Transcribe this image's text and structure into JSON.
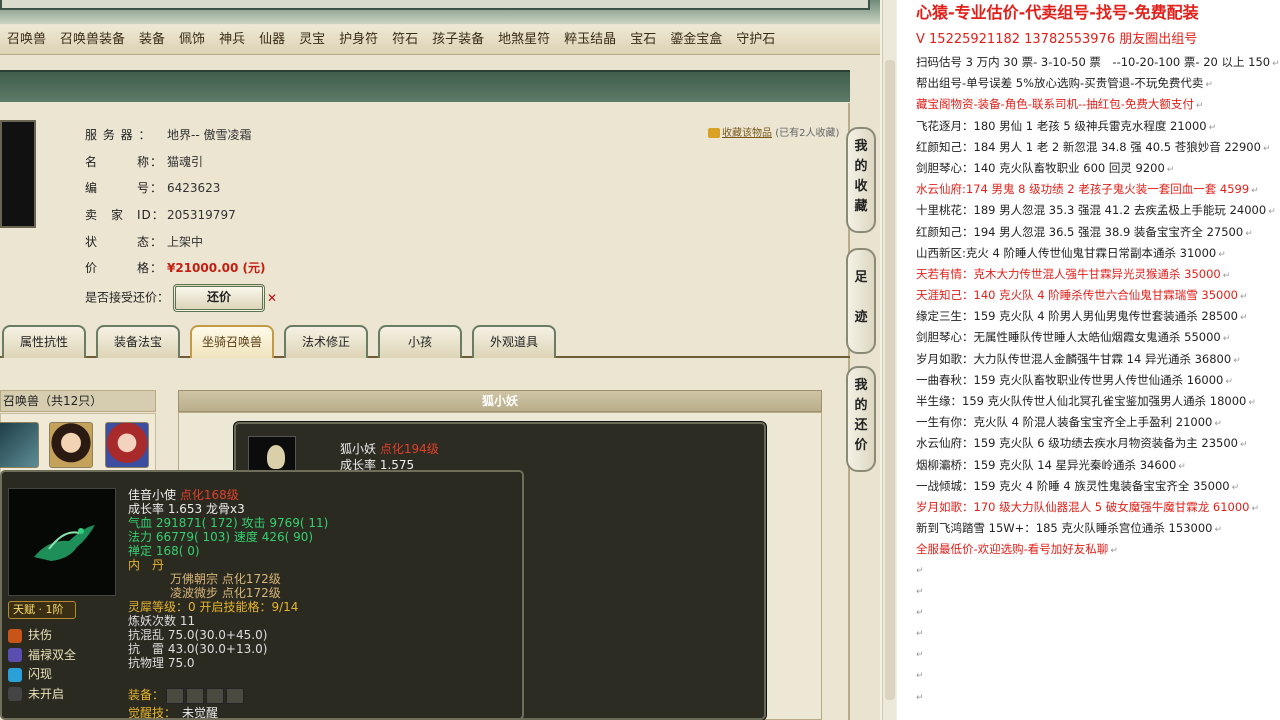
{
  "categories": [
    "召唤兽",
    "召唤兽装备",
    "装备",
    "佩饰",
    "神兵",
    "仙器",
    "灵宝",
    "护身符",
    "符石",
    "孩子装备",
    "地煞星符",
    "粹玉结晶",
    "宝石",
    "鎏金宝盒",
    "守护石"
  ],
  "listing": {
    "rows": [
      {
        "label": "服 务 器 ：",
        "value": "地界-- 傲雪凌霜"
      },
      {
        "label": "名　　　称：",
        "value": "猫魂引"
      },
      {
        "label": "编　　　号：",
        "value": "6423623"
      },
      {
        "label": "卖　家　ID：",
        "value": "205319797"
      },
      {
        "label": "状　　　态：",
        "value": "上架中"
      }
    ],
    "price_label": "价　　　格：",
    "price_value": "¥21000.00 (元)",
    "counter_label": "是否接受还价：",
    "counter_button": "还价",
    "counter_x": "✕",
    "fav_link": "收藏该物品",
    "fav_count": "(已有2人收藏)"
  },
  "tabs": [
    "属性抗性",
    "装备法宝",
    "坐骑召唤兽",
    "法术修正",
    "小孩",
    "外观道具"
  ],
  "pets": {
    "header": "召唤兽（共12只）",
    "detail_title": "狐小妖"
  },
  "tip_fox": {
    "name": "狐小妖",
    "level": "点化194级",
    "growth": "成长率 1.575"
  },
  "tip_bird": {
    "name": "佳音小使",
    "level": "点化168级",
    "growth": "成长率 1.653  龙骨x3",
    "hp": "气血 291871( 172) 攻击 9769( 11)",
    "mp": "法力 66779( 103) 速度 426( 90)",
    "zen": "禅定 168( 0)",
    "neidan": "内　丹",
    "neidan1": "万佛朝宗 点化172级",
    "neidan2": "凌波微步 点化172级",
    "soul": "灵犀等级：0 开启技能格：9/14",
    "refine": "炼妖次数 11",
    "resist1": "抗混乱 75.0(30.0+45.0)",
    "resist2": "抗　雷 43.0(30.0+13.0)",
    "resist3": "抗物理 75.0",
    "talent": "天赋 · 1阶",
    "skills": [
      "扶伤",
      "福禄双全",
      "闪现",
      "未开启"
    ],
    "equip_label": "装备：",
    "wake_label": "觉醒技：",
    "wake_value": "未觉醒"
  },
  "side_tabs": [
    "我的收藏",
    "足迹",
    "我的还价"
  ],
  "ad": {
    "title": "心猿-专业估价-代卖组号-找号-免费配装",
    "phone": "V 15225921182   13782553976 朋友圈出组号",
    "lines": [
      {
        "t": "扫码估号 3 万内 30 票- 3-10-50 票　--10-20-100 票- 20 以上 150",
        "r": false
      },
      {
        "t": "帮出组号-单号误差 5%放心选购-买贵管退-不玩免费代卖",
        "r": false
      },
      {
        "t": "藏宝阁物资-装备-角色-联系司机--抽红包-免费大额支付",
        "r": true
      },
      {
        "t": "飞花逐月：180 男仙 1 老孩 5 级神兵雷克水程度 21000",
        "r": false
      },
      {
        "t": "红颜知己：184 男人 1 老 2 新忽混 34.8 强 40.5 苍狼妙音 22900",
        "r": false
      },
      {
        "t": "剑胆琴心：140 克火队畜牧职业 600 回灵 9200",
        "r": false
      },
      {
        "t": "水云仙府:174 男鬼 8 级功绩 2 老孩子鬼火装一套回血一套 4599",
        "r": true
      },
      {
        "t": "十里桃花：189 男人忽混 35.3 强混 41.2 去疾孟极上手能玩 24000",
        "r": false
      },
      {
        "t": "红颜知己：194 男人忽混 36.5 强混 38.9 装备宝宝齐全 27500",
        "r": false
      },
      {
        "t": "山西新区:克火 4 阶睡人传世仙鬼甘霖日常副本通杀 31000",
        "r": false
      },
      {
        "t": "天若有情：克木大力传世混人强牛甘霖异光灵猴通杀 35000",
        "r": true
      },
      {
        "t": "天涯知己：140 克火队 4 阶睡杀传世六合仙鬼甘霖瑞雪 35000",
        "r": true
      },
      {
        "t": "缘定三生：159 克火队 4 阶男人男仙男鬼传世套装通杀 28500",
        "r": false
      },
      {
        "t": "剑胆琴心：无属性睡队传世睡人太皓仙烟霞女鬼通杀 55000",
        "r": false
      },
      {
        "t": "岁月如歌：大力队传世混人金麟强牛甘霖 14 异光通杀 36800",
        "r": false
      },
      {
        "t": "一曲春秋：159 克火队畜牧职业传世男人传世仙通杀 16000",
        "r": false
      },
      {
        "t": "半生缘：159 克火队传世人仙北冥孔雀宝鉴加强男人通杀 18000",
        "r": false
      },
      {
        "t": "一生有你：克火队 4 阶混人装备宝宝齐全上手盈利 21000",
        "r": false
      },
      {
        "t": "水云仙府：159 克火队 6 级功绩去疾水月物资装备为主 23500",
        "r": false
      },
      {
        "t": "烟柳灞桥：159 克火队 14 星异光秦岭通杀 34600",
        "r": false
      },
      {
        "t": "一战倾城：159 克火 4 阶睡 4 族灵性鬼装备宝宝齐全 35000",
        "r": false
      },
      {
        "t": "岁月如歌：170 级大力队仙器混人 5 破女魔强牛魔甘霖龙 61000",
        "r": true
      },
      {
        "t": "新到飞鸿踏雪 15W+：185 克火队睡杀宫位通杀 153000",
        "r": false
      },
      {
        "t": "全服最低价-欢迎选购-看号加好友私聊",
        "r": true
      }
    ],
    "return_mark": "↵"
  }
}
